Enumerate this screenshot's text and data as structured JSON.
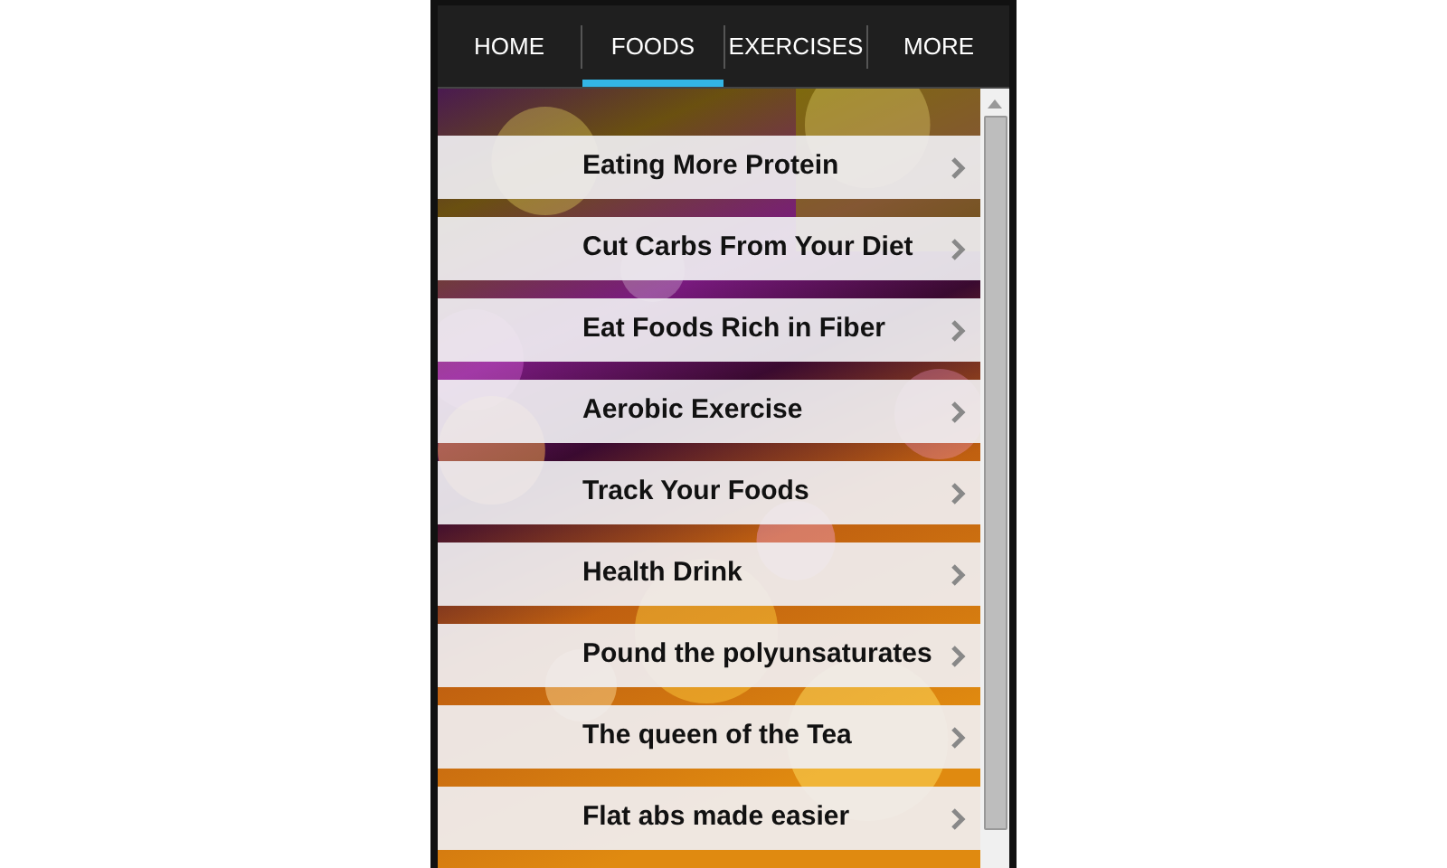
{
  "tabs": [
    {
      "label": "HOME",
      "selected": false
    },
    {
      "label": "FOODS",
      "selected": true
    },
    {
      "label": "EXERCISES",
      "selected": false
    },
    {
      "label": "MORE",
      "selected": false
    }
  ],
  "items": [
    {
      "label": "Eating More Protein"
    },
    {
      "label": "Cut Carbs From Your Diet"
    },
    {
      "label": "Eat Foods Rich in Fiber"
    },
    {
      "label": "Aerobic Exercise"
    },
    {
      "label": "Track Your Foods"
    },
    {
      "label": "Health Drink"
    },
    {
      "label": "Pound the polyunsaturates"
    },
    {
      "label": "The queen of the Tea"
    },
    {
      "label": "Flat abs made easier"
    }
  ]
}
